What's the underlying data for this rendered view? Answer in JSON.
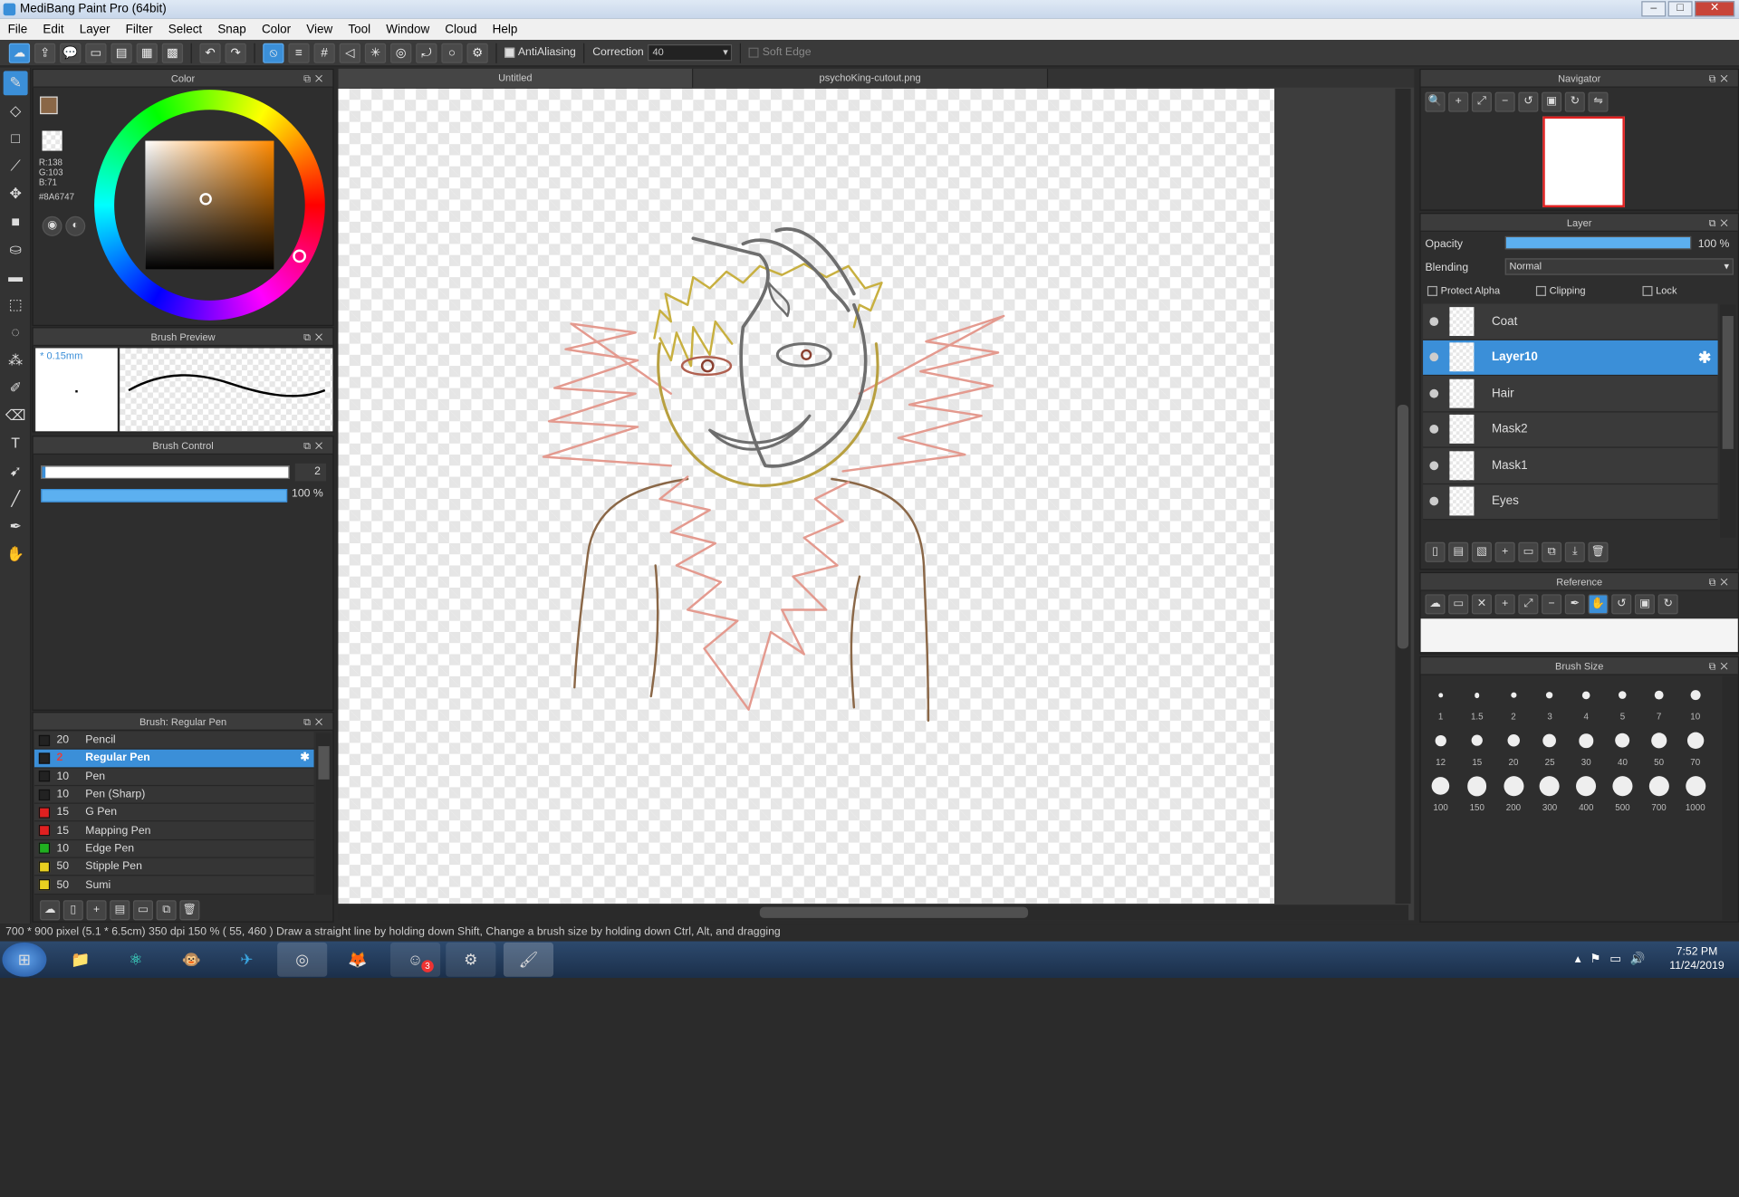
{
  "window": {
    "title": "MediBang Paint Pro (64bit)",
    "minimize": "–",
    "maximize": "□",
    "close": "✕"
  },
  "menu": [
    "File",
    "Edit",
    "Layer",
    "Filter",
    "Select",
    "Snap",
    "Color",
    "View",
    "Tool",
    "Window",
    "Cloud",
    "Help"
  ],
  "toolbar": {
    "antialiasing": "AntiAliasing",
    "correction_label": "Correction",
    "correction_value": "40",
    "soft_edge": "Soft Edge"
  },
  "tabs": [
    {
      "label": "Untitled"
    },
    {
      "label": "psychoKing-cutout.png"
    }
  ],
  "color_panel": {
    "title": "Color",
    "r": "R:138",
    "g": "G:103",
    "b": "B:71",
    "hex": "#8A6747",
    "fg_color": "#8a6747"
  },
  "brush_preview": {
    "title": "Brush Preview",
    "size": "0.15mm"
  },
  "brush_control": {
    "title": "Brush Control",
    "size_value": "2",
    "opacity_value": "100 %"
  },
  "brush_list": {
    "title": "Brush: Regular Pen",
    "items": [
      {
        "size": "20",
        "name": "Pencil",
        "color": "#222222"
      },
      {
        "size": "2",
        "name": "Regular Pen",
        "color": "#222222"
      },
      {
        "size": "10",
        "name": "Pen",
        "color": "#222222"
      },
      {
        "size": "10",
        "name": "Pen (Sharp)",
        "color": "#222222"
      },
      {
        "size": "15",
        "name": "G Pen",
        "color": "#e02020"
      },
      {
        "size": "15",
        "name": "Mapping Pen",
        "color": "#e02020"
      },
      {
        "size": "10",
        "name": "Edge Pen",
        "color": "#20b020"
      },
      {
        "size": "50",
        "name": "Stipple Pen",
        "color": "#e8d020"
      },
      {
        "size": "50",
        "name": "Sumi",
        "color": "#e8d020"
      }
    ]
  },
  "navigator": {
    "title": "Navigator"
  },
  "layer_panel": {
    "title": "Layer",
    "opacity_label": "Opacity",
    "opacity_value": "100 %",
    "opacity_level": 1.0,
    "blending_label": "Blending",
    "blending_value": "Normal",
    "protect_alpha": "Protect Alpha",
    "clipping": "Clipping",
    "lock": "Lock",
    "layers": [
      {
        "name": "Coat"
      },
      {
        "name": "Layer10"
      },
      {
        "name": "Hair"
      },
      {
        "name": "Mask2"
      },
      {
        "name": "Mask1"
      },
      {
        "name": "Eyes"
      }
    ]
  },
  "reference": {
    "title": "Reference"
  },
  "brush_size": {
    "title": "Brush Size",
    "sizes": [
      "1",
      "1.5",
      "2",
      "3",
      "4",
      "5",
      "7",
      "10",
      "12",
      "15",
      "20",
      "25",
      "30",
      "40",
      "50",
      "70",
      "100",
      "150",
      "200",
      "300",
      "400",
      "500",
      "700",
      "1000"
    ]
  },
  "status": {
    "text": "700 * 900 pixel   (5.1 * 6.5cm)   350 dpi   150 %   ( 55, 460 )   Draw a straight line by holding down Shift, Change a brush size by holding down Ctrl, Alt, and dragging"
  },
  "taskbar": {
    "time": "7:52 PM",
    "date": "11/24/2019",
    "discord_badge": "3"
  }
}
